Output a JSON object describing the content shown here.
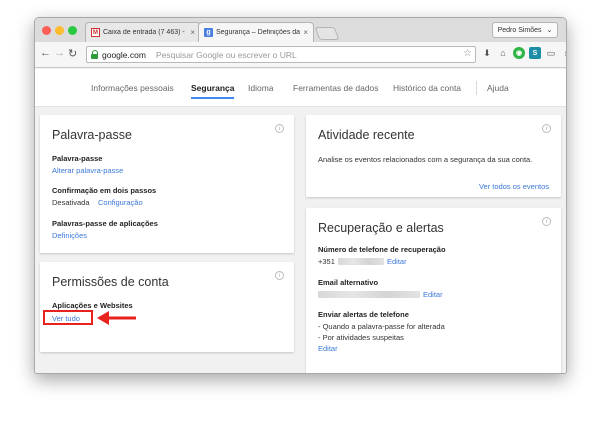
{
  "browser": {
    "tabs": [
      {
        "title": "Caixa de entrada (7 463) - p",
        "icon": "gmail-icon",
        "active": false
      },
      {
        "title": "Segurança – Definições da",
        "icon": "google-security-icon",
        "active": true
      }
    ],
    "profile_name": "Pedro Simões",
    "url": "google.com",
    "omnibox_placeholder": "Pesquisar Google ou escrever o URL"
  },
  "topnav": {
    "items": [
      "Informações pessoais",
      "Segurança",
      "Idioma",
      "Ferramentas de dados",
      "Histórico da conta",
      "Ajuda"
    ],
    "active": "Segurança"
  },
  "password_card": {
    "title": "Palavra-passe",
    "password_label": "Palavra-passe",
    "change_password_link": "Alterar palavra-passe",
    "two_step_label": "Confirmação em dois passos",
    "two_step_status": "Desativada",
    "two_step_config_link": "Configuração",
    "app_passwords_label": "Palavras-passe de aplicações",
    "app_passwords_link": "Definições"
  },
  "permissions_card": {
    "title": "Permissões de conta",
    "apps_label": "Aplicações e Websites",
    "see_all_link": "Ver tudo"
  },
  "activity_card": {
    "title": "Atividade recente",
    "description": "Analise os eventos relacionados com a segurança da sua conta.",
    "see_events_link": "Ver todos os eventos"
  },
  "recovery_card": {
    "title": "Recuperação e alertas",
    "phone_label": "Número de telefone de recuperação",
    "phone_prefix": "+351",
    "phone_edit_link": "Editar",
    "email_label": "Email alternativo",
    "email_edit_link": "Editar",
    "alerts_label": "Enviar alertas de telefone",
    "alert_items": [
      "- Quando a palavra-passe for alterada",
      "- Por atividades suspeitas"
    ],
    "alerts_edit_link": "Editar"
  },
  "colors": {
    "link": "#3c78d8",
    "accent": "#4285f4",
    "highlight": "#e8231e"
  }
}
